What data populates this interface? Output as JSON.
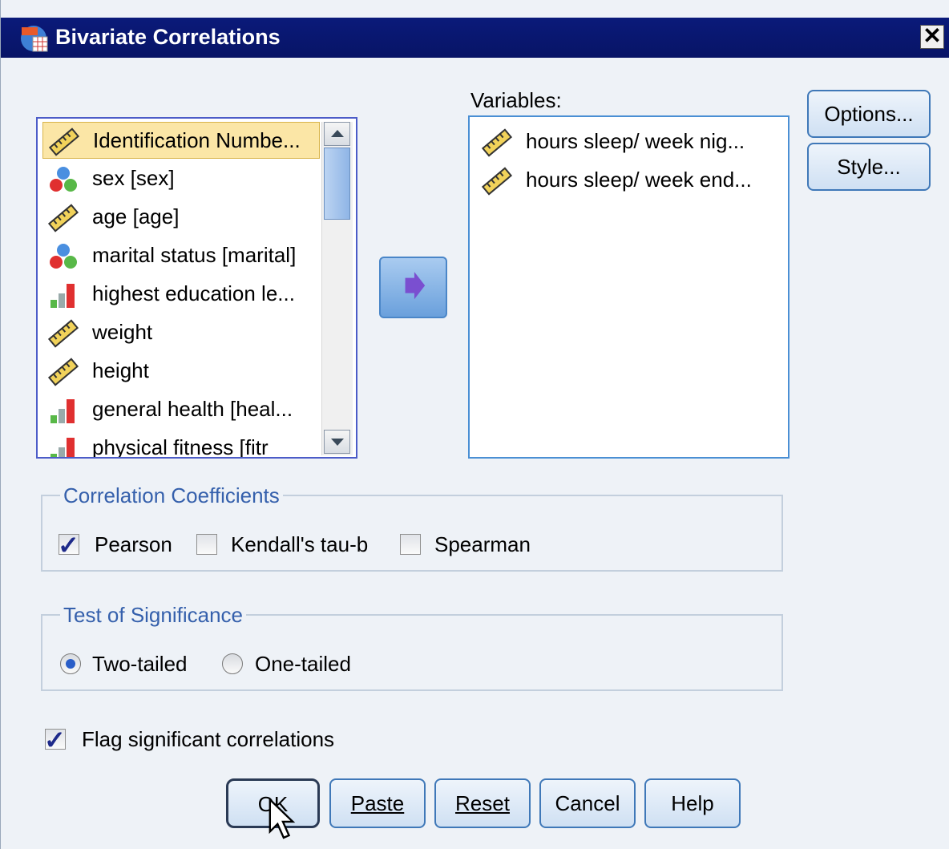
{
  "window": {
    "title": "Bivariate Correlations",
    "close_label": "✕"
  },
  "source_list": {
    "items": [
      {
        "label": "Identification Numbe...",
        "icon": "ruler-icon",
        "selected": true
      },
      {
        "label": "sex [sex]",
        "icon": "nominal-icon"
      },
      {
        "label": "age [age]",
        "icon": "ruler-icon"
      },
      {
        "label": "marital status [marital]",
        "icon": "nominal-icon"
      },
      {
        "label": "highest education le...",
        "icon": "ordinal-icon"
      },
      {
        "label": "weight",
        "icon": "ruler-icon"
      },
      {
        "label": "height",
        "icon": "ruler-icon"
      },
      {
        "label": "general health [heal...",
        "icon": "ordinal-icon"
      },
      {
        "label": "physical fitness [fitr",
        "icon": "ordinal-icon"
      }
    ]
  },
  "target": {
    "label": "Variables:",
    "items": [
      {
        "label": "hours sleep/ week nig...",
        "icon": "ruler-icon"
      },
      {
        "label": "hours sleep/ week end...",
        "icon": "ruler-icon"
      }
    ]
  },
  "side_buttons": {
    "options": "Options...",
    "style": "Style..."
  },
  "correlation": {
    "title": "Correlation Coefficients",
    "pearson": {
      "label": "Pearson",
      "checked": true
    },
    "kendall": {
      "label": "Kendall's tau-b",
      "checked": false
    },
    "spearman": {
      "label": "Spearman",
      "checked": false
    }
  },
  "significance": {
    "title": "Test of Significance",
    "two_tailed": {
      "label": "Two-tailed",
      "selected": true
    },
    "one_tailed": {
      "label": "One-tailed",
      "selected": false
    }
  },
  "flag": {
    "label": "Flag significant correlations",
    "checked": true
  },
  "buttons": {
    "ok": "OK",
    "paste": "Paste",
    "reset": "Reset",
    "cancel": "Cancel",
    "help": "Help"
  },
  "colors": {
    "title_bar": "#0a1a7a",
    "selection": "#fbe6a6",
    "accent": "#3f78b8"
  }
}
